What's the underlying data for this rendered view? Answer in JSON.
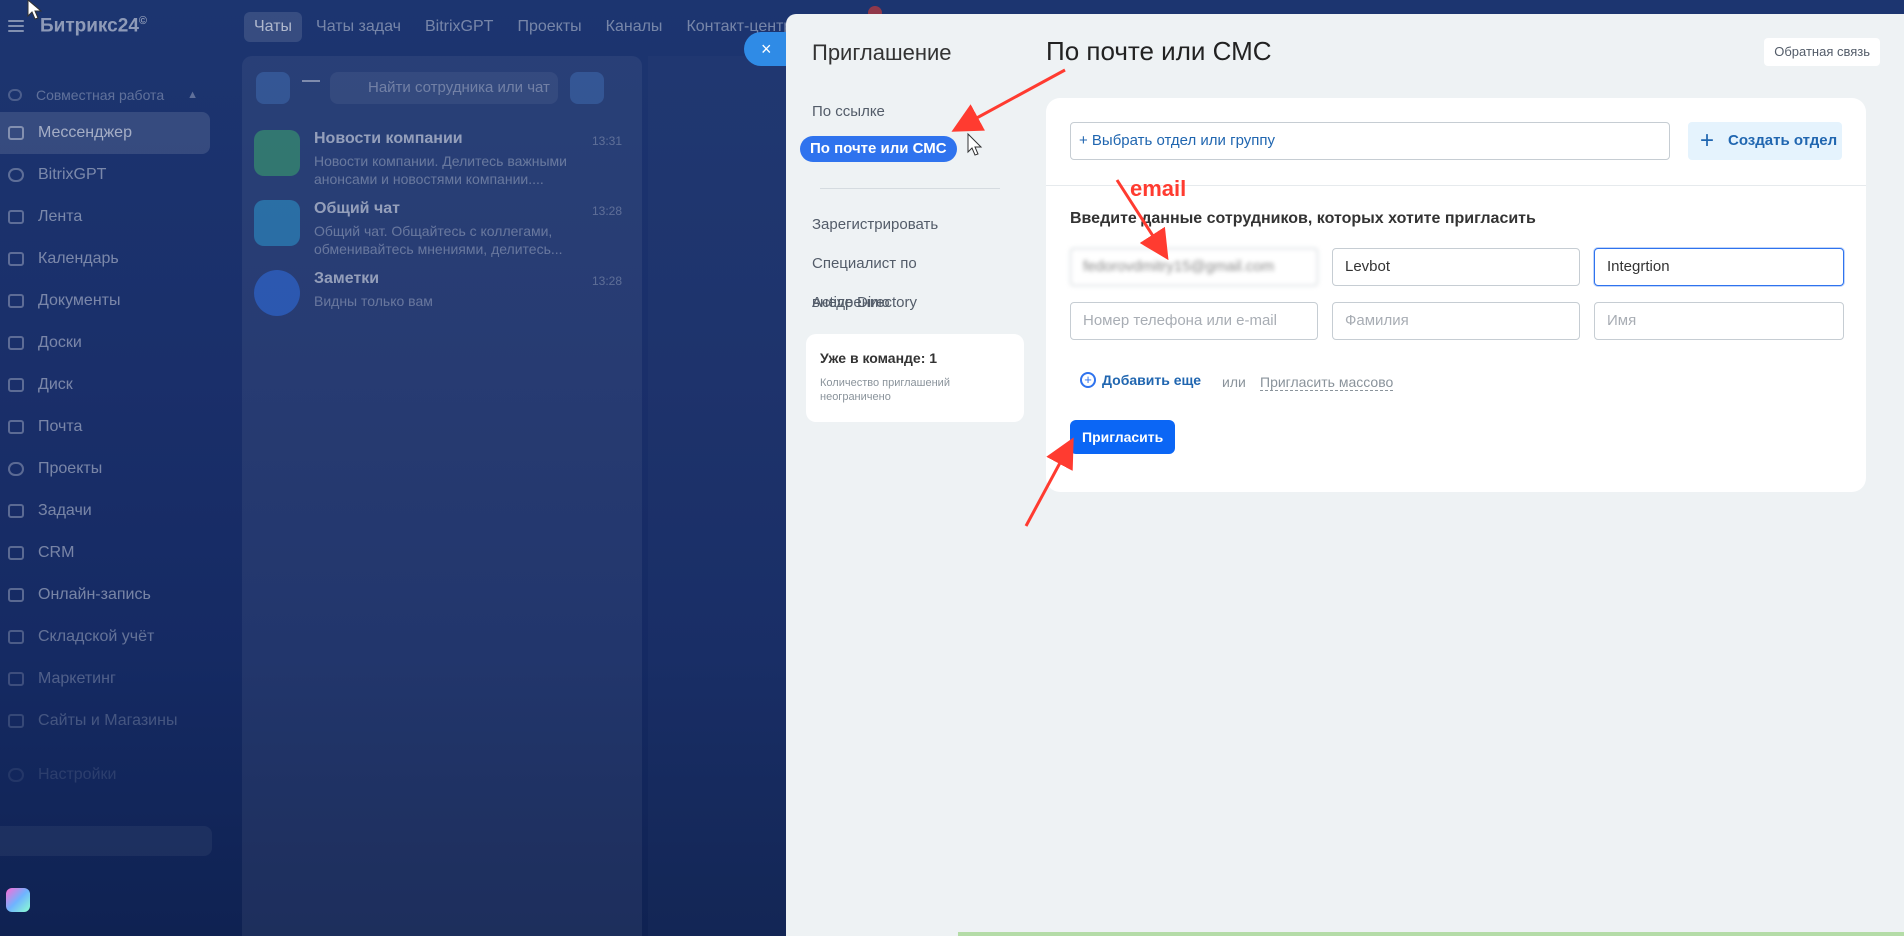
{
  "app": {
    "logo": "Битрикс24",
    "logo_mark": "©",
    "top_tabs": [
      "Чаты",
      "Чаты задач",
      "BitrixGPT",
      "Проекты",
      "Каналы",
      "Контакт-центр"
    ]
  },
  "sidebar": {
    "group": "Совместная работа",
    "items": [
      "Мессенджер",
      "BitrixGPT",
      "Лента",
      "Календарь",
      "Документы",
      "Доски",
      "Диск",
      "Почта",
      "Проекты",
      "Задачи",
      "CRM",
      "Онлайн-запись",
      "Складской учёт",
      "Маркетинг",
      "Сайты и Магазины",
      "Настройки"
    ]
  },
  "chats": {
    "search_placeholder": "Найти сотрудника или чат",
    "items": [
      {
        "name": "Новости компании",
        "preview": "Новости компании. Делитесь важными анонсами и новостями компании....",
        "time": "13:31"
      },
      {
        "name": "Общий чат",
        "preview": "Общий чат. Общайтесь с коллегами, обменивайтесь мнениями, делитесь...",
        "time": "13:28"
      },
      {
        "name": "Заметки",
        "preview": "Видны только вам",
        "time": "13:28"
      }
    ]
  },
  "slider": {
    "close": "×",
    "title": "Приглашение",
    "feedback": "Обратная связь",
    "nav": {
      "by_link": "По ссылке",
      "by_email": "По почте или СМС",
      "register": "Зарегистрировать",
      "specialist": "Специалист по внедрению",
      "ad": "Active Directory"
    },
    "team": {
      "label": "Уже в команде:",
      "count": "1",
      "sub": "Количество приглашений неограничено"
    },
    "form": {
      "dept_select": "+ Выбрать отдел или группу",
      "create_dept": "Создать отдел",
      "title": "Введите данные сотрудников, которых хотите пригласить",
      "row1": {
        "contact": "fedorovdmitry15@gmail.com",
        "last_name": "Levbot",
        "first_name": "Integrtion"
      },
      "row2": {
        "contact_ph": "Номер телефона или e-mail",
        "last_name_ph": "Фамилия",
        "first_name_ph": "Имя"
      },
      "add_more": "Добавить еще",
      "or": "или",
      "mass_invite": "Пригласить массово",
      "submit": "Пригласить"
    }
  },
  "annotations": {
    "heading": "По почте или СМС",
    "email": "email",
    "color": "#ff3b30"
  }
}
